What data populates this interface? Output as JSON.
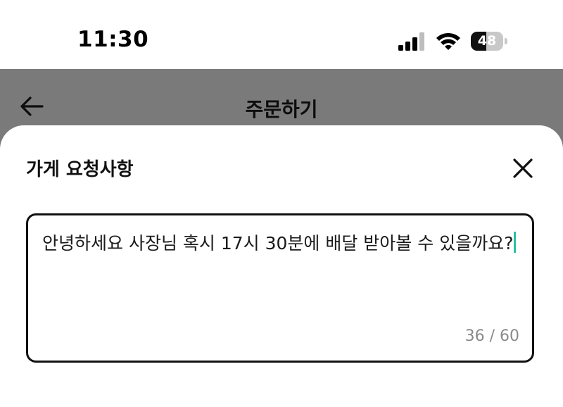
{
  "status_bar": {
    "time": "11:30",
    "battery_level": "48",
    "battery_fraction": 0.48,
    "icons": [
      "cellular-signal-icon",
      "wifi-icon",
      "battery-icon"
    ]
  },
  "header": {
    "title": "주문하기",
    "back_icon": "arrow-left-icon"
  },
  "sheet": {
    "title": "가게 요청사항",
    "close_icon": "close-icon",
    "request_input": {
      "value": "안녕하세요 사장님 혹시 17시 30분에 배달 받아볼 수 있을까요?",
      "counter": "36 / 60"
    }
  },
  "colors": {
    "overlay": "#7a7a7a",
    "caret": "#2bbfa4",
    "counter": "#8a8a8a"
  }
}
